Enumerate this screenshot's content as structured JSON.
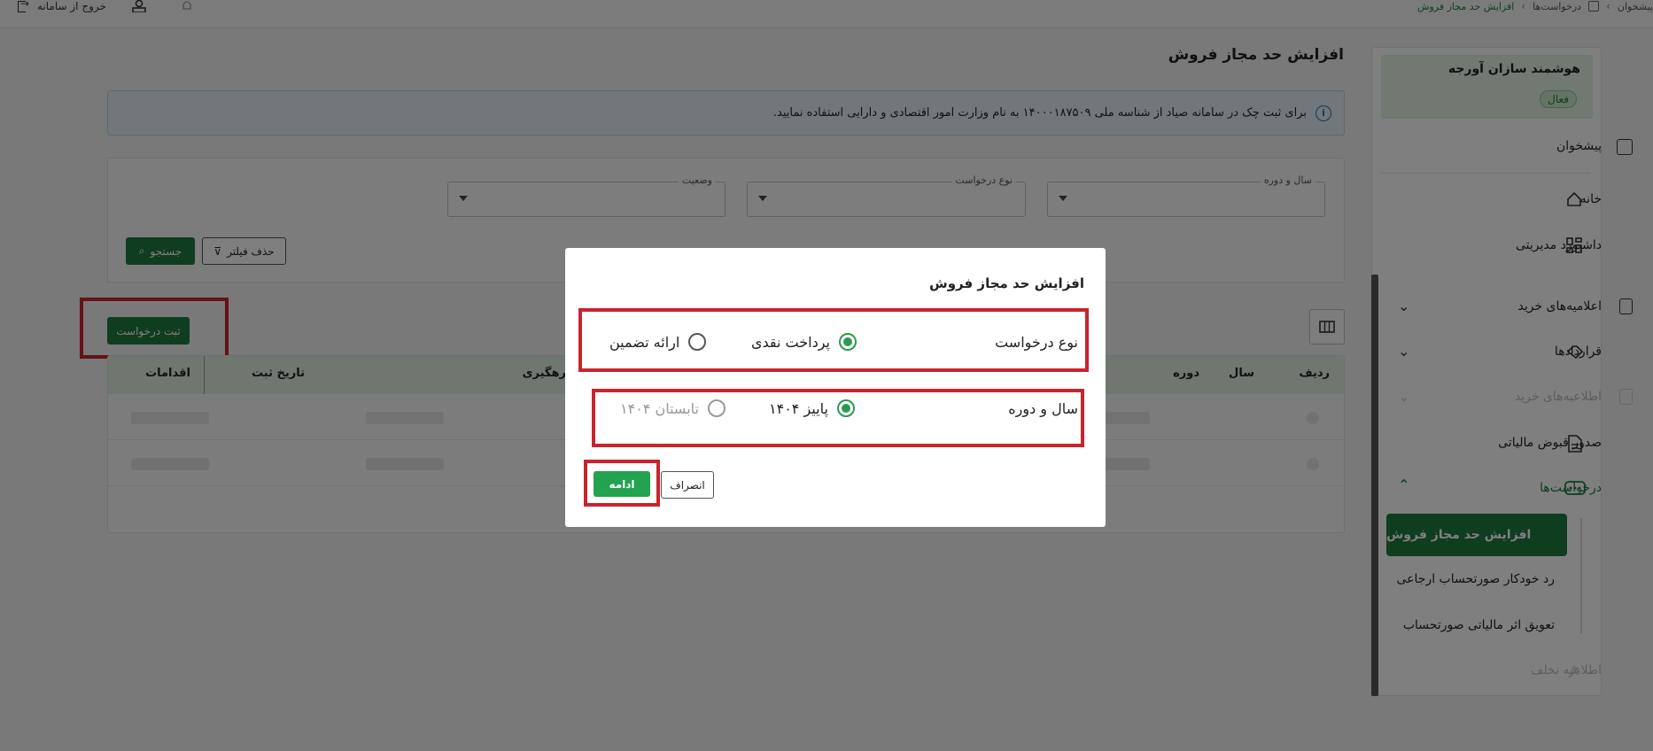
{
  "topbar": {
    "breadcrumb": [
      "پیشخوان",
      "درخواست‌ها",
      "افزایش حد مجاز فروش"
    ],
    "exit_label": "خروج از سامانه"
  },
  "sidebar": {
    "company_name": "هوشمند سازان آورجه",
    "company_status": "فعال",
    "items": [
      {
        "label": "پیشخوان",
        "icon": "dashboard-icon"
      },
      {
        "label": "خانه",
        "icon": "home-icon"
      },
      {
        "label": "داشبورد مدیریتی",
        "icon": "grid-icon"
      },
      {
        "label": "اعلامیه‌های خرید",
        "icon": "receipt-icon"
      },
      {
        "label": "قراردادها",
        "icon": "handshake-icon"
      },
      {
        "label": "اطلاعیه‌های خرید",
        "icon": "clipboard-icon"
      },
      {
        "label": "صدور قبوض مالیاتی",
        "icon": "document-icon"
      },
      {
        "label": "درخواست‌ها",
        "icon": "ellipsis-icon"
      }
    ],
    "sub_items": [
      "افزایش حد مجاز فروش",
      "رد خودکار صورتحساب ارجاعی",
      "تعویق اثر مالیاتی صورتحساب",
      "اطلاعیه تخلف"
    ]
  },
  "main": {
    "title": "افزایش حد مجاز فروش",
    "info": "برای ثبت چک در سامانه صیاد از شناسه ملی ۱۴۰۰۰۱۸۷۵۰۹ به نام وزارت امور اقتصادی و دارایی استفاده نمایید.",
    "filters": {
      "year_period": "سال و دوره",
      "request_type": "نوع درخواست",
      "status": "وضعیت"
    },
    "clear_filter": "حذف فیلتر",
    "search": "جستجو",
    "submit_request": "ثبت درخواست",
    "columns": [
      "ردیف",
      "سال",
      "دوره",
      "رهگیری",
      "تاریخ ثبت",
      "اقدامات"
    ]
  },
  "modal": {
    "title": "افزایش حد مجاز فروش",
    "request_type_label": "نوع درخواست",
    "request_options": [
      {
        "label": "پرداخت نقدی",
        "checked": true
      },
      {
        "label": "ارائه تضمین",
        "checked": false
      }
    ],
    "period_label": "سال و دوره",
    "period_options": [
      {
        "label": "پاییز ۱۴۰۴",
        "checked": true
      },
      {
        "label": "تابستان ۱۴۰۴",
        "checked": false
      }
    ],
    "continue": "ادامه",
    "cancel": "انصراف"
  },
  "colors": {
    "primary": "#1f7a3f",
    "radio_checked": "#2a9a52",
    "highlight": "#c8242e",
    "info_bg": "#e3eef7"
  }
}
